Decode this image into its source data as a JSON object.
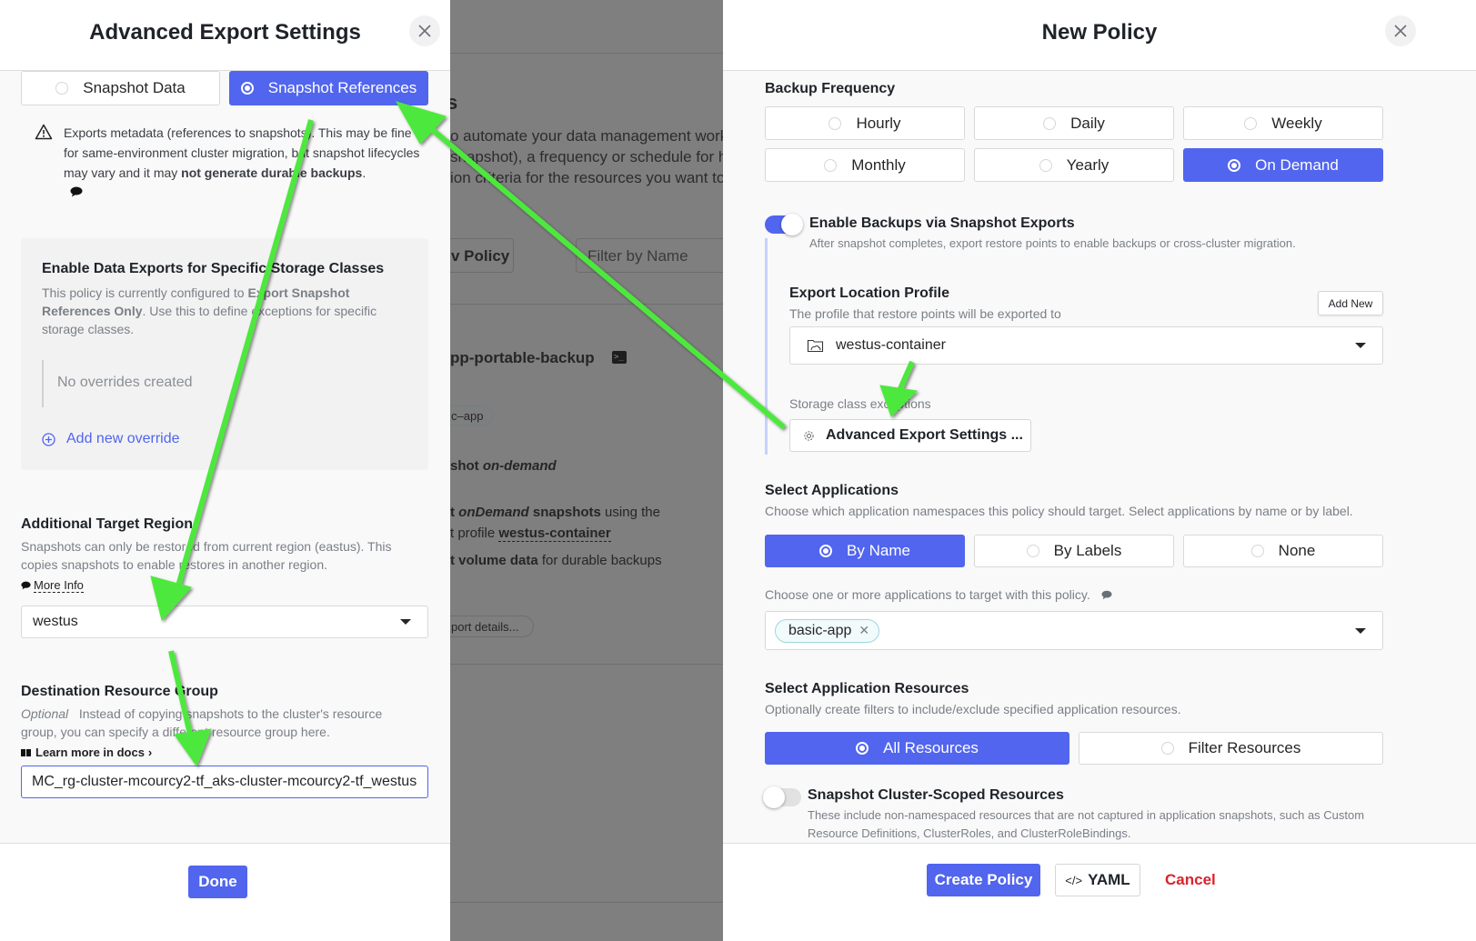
{
  "background_page": {
    "description_lines": [
      "o automate your data management workf",
      "snapshot), a frequency or schedule for ho",
      "ion criteria for the resources you want to r"
    ],
    "title_fragment": "s",
    "new_policy_button": "v Policy",
    "filter_placeholder": "Filter by Name",
    "policy_name": "pp-portable-backup",
    "app_chip": "c–app",
    "action_line": "shot",
    "action_line_em": "on-demand",
    "export_line_1_pre": "t",
    "export_line_1_em": "onDemand",
    "export_line_1_bold": "snapshots",
    "export_line_1_post": "using the",
    "export_line_2_pre": "t profile",
    "export_line_2_bold": "westus-container",
    "export_line_3_bold": "t volume data",
    "export_line_3_post": "for durable backups",
    "details_pill": "port details..."
  },
  "left_panel": {
    "title": "Advanced Export Settings",
    "close_icon": "close-icon",
    "export_mode": {
      "options": [
        {
          "label": "Snapshot Data",
          "selected": false
        },
        {
          "label": "Snapshot References",
          "selected": true
        }
      ]
    },
    "warning": {
      "icon": "warning-triangle-icon",
      "text_pre": "Exports metadata (references to snapshots). This may be fine for same-environment cluster migration, but snapshot lifecycles may vary and it may ",
      "text_bold": "not generate durable backups",
      "text_post": ".",
      "tooltip_icon": "comment-icon"
    },
    "storage_overrides": {
      "title": "Enable Data Exports for Specific Storage Classes",
      "desc_pre": "This policy is currently configured to ",
      "desc_bold": "Export Snapshot References Only",
      "desc_post": ". Use this to define exceptions for specific storage classes.",
      "empty_text": "No overrides created",
      "add_link": "Add new override"
    },
    "target_region": {
      "title": "Additional Target Region",
      "desc": "Snapshots can only be restored from current region (eastus). This copies snapshots to enable restores in another region.",
      "more_info": "More Info",
      "selected": "westus"
    },
    "resource_group": {
      "title": "Destination Resource Group",
      "optional_label": "Optional",
      "desc": "Instead of copying snapshots to the cluster's resource group, you can specify a different resource group here.",
      "docs_link": "Learn more in docs",
      "value": "MC_rg-cluster-mcourcy2-tf_aks-cluster-mcourcy2-tf_westus"
    },
    "done_button": "Done"
  },
  "right_panel": {
    "title": "New Policy",
    "close_icon": "close-icon",
    "backup_frequency": {
      "label": "Backup Frequency",
      "options": [
        {
          "label": "Hourly",
          "selected": false
        },
        {
          "label": "Daily",
          "selected": false
        },
        {
          "label": "Weekly",
          "selected": false
        },
        {
          "label": "Monthly",
          "selected": false
        },
        {
          "label": "Yearly",
          "selected": false
        },
        {
          "label": "On Demand",
          "selected": true
        }
      ]
    },
    "snapshot_exports": {
      "enabled": true,
      "label": "Enable Backups via Snapshot Exports",
      "desc": "After snapshot completes, export restore points to enable backups or cross-cluster migration."
    },
    "export_location": {
      "label": "Export Location Profile",
      "desc": "The profile that restore points will be exported to",
      "add_new": "Add New",
      "selected": "westus-container",
      "storage_class_label": "Storage class exceptions",
      "advanced_button": "Advanced Export Settings ..."
    },
    "select_applications": {
      "label": "Select Applications",
      "desc": "Choose which application namespaces this policy should target. Select applications by name or by label.",
      "options": [
        {
          "label": "By Name",
          "selected": true
        },
        {
          "label": "By Labels",
          "selected": false
        },
        {
          "label": "None",
          "selected": false
        }
      ],
      "apps_hint": "Choose one or more applications to target with this policy.",
      "selected_apps": [
        "basic-app"
      ]
    },
    "select_resources": {
      "label": "Select Application Resources",
      "desc": "Optionally create filters to include/exclude specified application resources.",
      "options": [
        {
          "label": "All Resources",
          "selected": true
        },
        {
          "label": "Filter Resources",
          "selected": false
        }
      ]
    },
    "cluster_scoped": {
      "enabled": false,
      "label": "Snapshot Cluster-Scoped Resources",
      "desc": "These include non-namespaced resources that are not captured in application snapshots, such as Custom Resource Definitions, ClusterRoles, and ClusterRoleBindings."
    },
    "footer": {
      "create_button": "Create Policy",
      "yaml_button": "YAML",
      "cancel_button": "Cancel"
    }
  },
  "colors": {
    "accent": "#5165ee",
    "danger": "#d9232d",
    "annotation_arrow": "#4ee83c"
  }
}
